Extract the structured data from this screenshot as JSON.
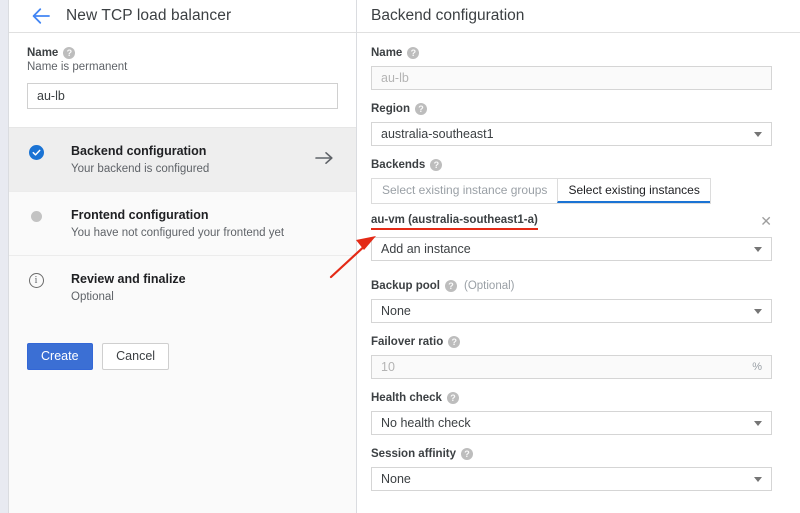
{
  "left_panel": {
    "back_icon": "back-arrow-icon",
    "title": "New TCP load balancer",
    "name_field": {
      "label": "Name",
      "help_icon": "help-icon",
      "sub": "Name is permanent",
      "value": "au-lb"
    },
    "steps": [
      {
        "icon": "check-circle-icon",
        "title": "Backend configuration",
        "sub": "Your backend is configured",
        "go_icon": "arrow-right-icon",
        "state": "complete"
      },
      {
        "icon": "grey-dot-icon",
        "title": "Frontend configuration",
        "sub": "You have not configured your frontend yet",
        "state": "pending"
      },
      {
        "icon": "info-circle-icon",
        "title": "Review and finalize",
        "sub": "Optional",
        "state": "optional"
      }
    ],
    "buttons": {
      "create": "Create",
      "cancel": "Cancel"
    }
  },
  "right_panel": {
    "title": "Backend configuration",
    "name": {
      "label": "Name",
      "value": "au-lb",
      "disabled": true
    },
    "region": {
      "label": "Region",
      "value": "australia-southeast1"
    },
    "backends": {
      "label": "Backends",
      "tabs": [
        {
          "label": "Select existing instance groups",
          "active": false
        },
        {
          "label": "Select existing instances",
          "active": true
        }
      ],
      "instance": {
        "name": "au-vm (australia-southeast1-a)",
        "remove_icon": "close-icon"
      },
      "add_instance": "Add an instance"
    },
    "backup_pool": {
      "label": "Backup pool",
      "optional": "(Optional)",
      "value": "None"
    },
    "failover_ratio": {
      "label": "Failover ratio",
      "value": "10",
      "suffix": "%"
    },
    "health_check": {
      "label": "Health check",
      "value": "No health check"
    },
    "session_affinity": {
      "label": "Session affinity",
      "value": "None"
    }
  },
  "annotation": {
    "arrow_color": "#e42a16",
    "underline_color": "#e42a16"
  }
}
